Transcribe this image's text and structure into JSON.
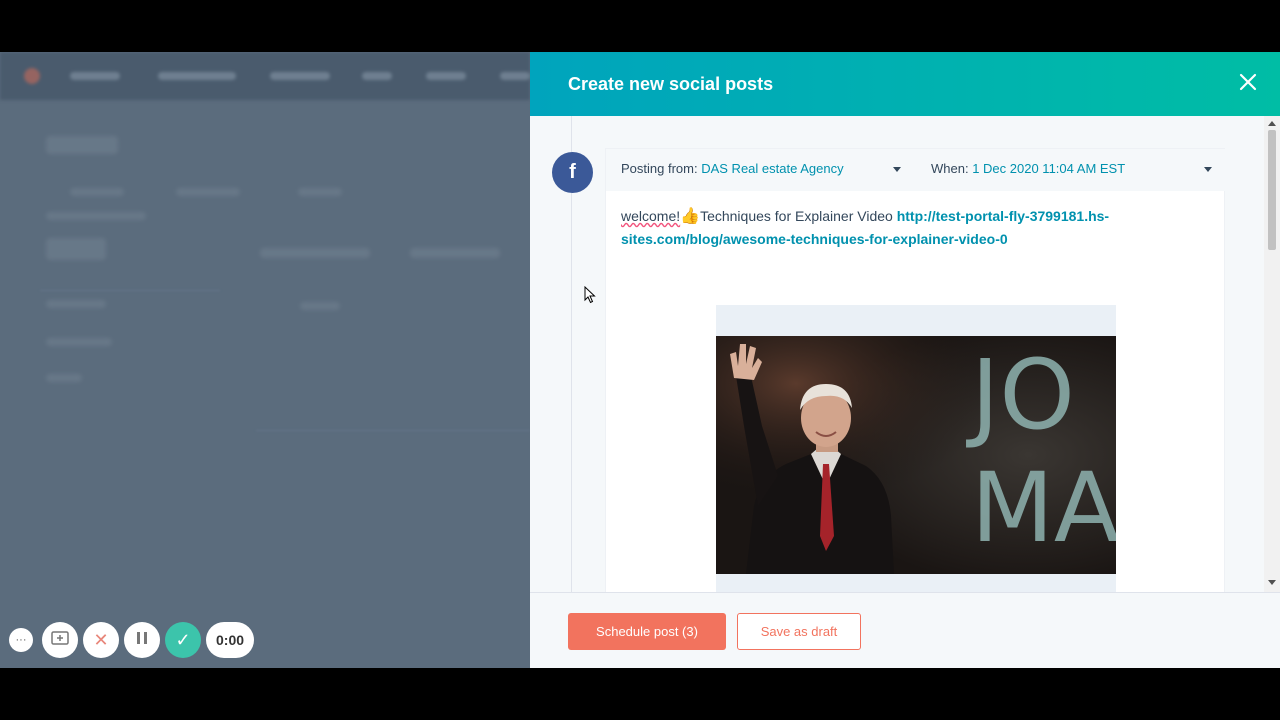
{
  "panel": {
    "title": "Create new social posts",
    "close_icon": "close-icon"
  },
  "post": {
    "network_icon": "facebook-icon",
    "posting_from_label": "Posting from:",
    "posting_from_value": "DAS Real estate Agency",
    "when_label": "When:",
    "when_value": "1 Dec 2020 11:04 AM EST",
    "text_word": "welcome!",
    "text_emoji": "👍",
    "text_body": "Techniques for Explainer Video ",
    "text_link": "http://test-portal-fly-3799181.hs-sites.com/blog/awesome-techniques-for-explainer-video-0",
    "image_text_line1": "JO",
    "image_text_line2": "MA"
  },
  "footer": {
    "schedule_label": "Schedule post (3)",
    "draft_label": "Save as draft"
  },
  "recorder": {
    "more_label": "···",
    "time": "0:00"
  },
  "colors": {
    "header_start": "#00a4bd",
    "header_end": "#00bda5",
    "primary_button": "#f2735e",
    "link": "#0091ae",
    "facebook": "#3b5998"
  }
}
